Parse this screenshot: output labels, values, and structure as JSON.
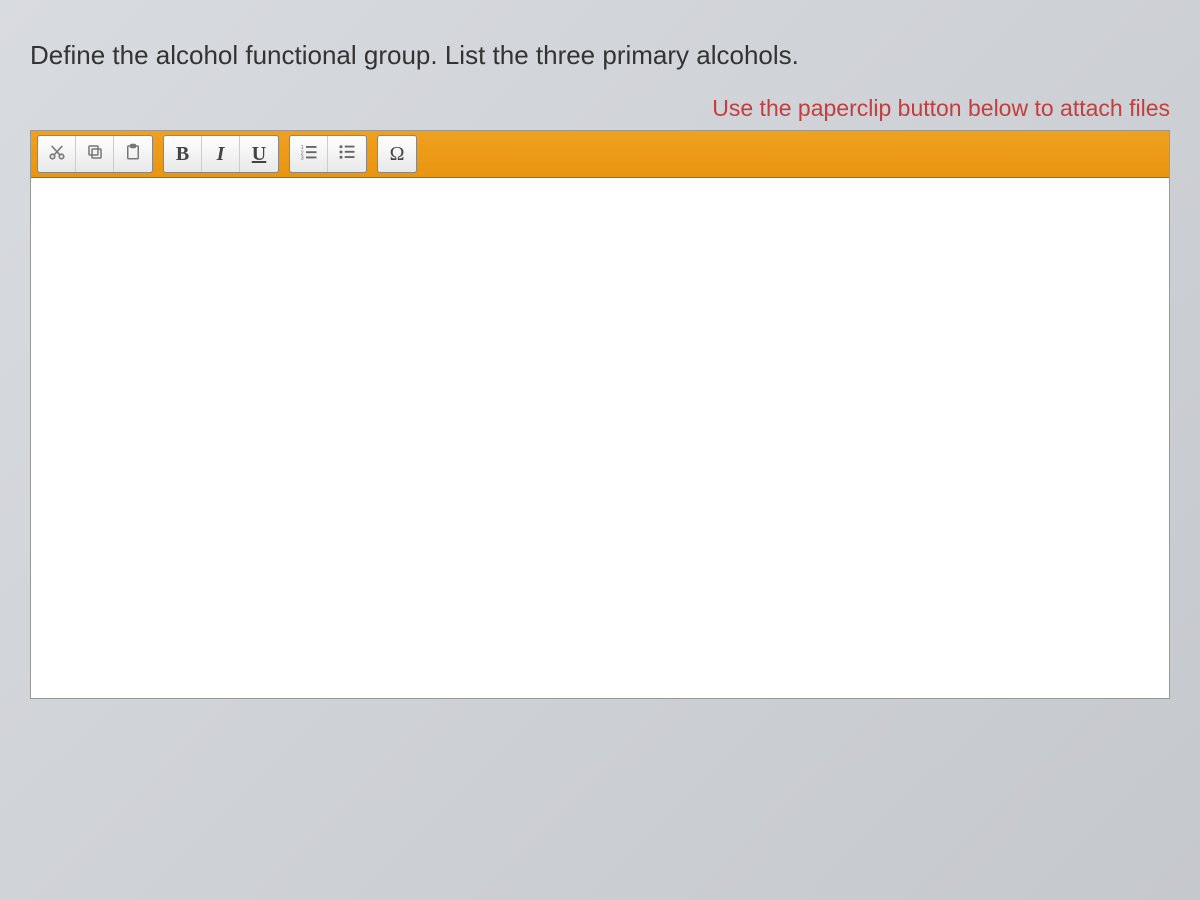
{
  "question": "Define the alcohol functional group. List the three primary alcohols.",
  "instruction": "Use the paperclip button below to attach files",
  "toolbar": {
    "cut": "✕",
    "bold": "B",
    "italic": "I",
    "underline": "U",
    "omega": "Ω"
  },
  "editor": {
    "content": ""
  }
}
